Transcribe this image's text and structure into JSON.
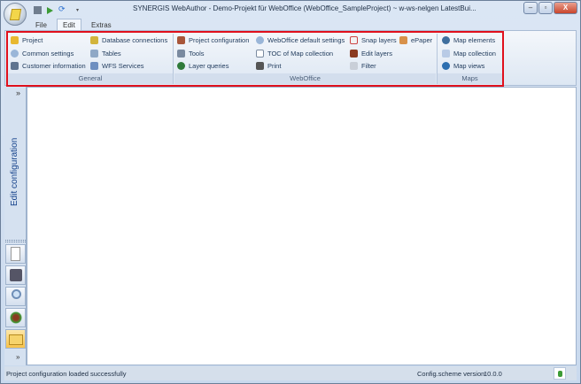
{
  "window": {
    "title": "SYNERGIS WebAuthor - Demo-Projekt für WebOffice (WebOffice_SampleProject) ~ w-ws-nelgen LatestBui...",
    "minimize": "–",
    "maximize": "▫",
    "close": "X"
  },
  "tabs": [
    {
      "label": "File"
    },
    {
      "label": "Edit"
    },
    {
      "label": "Extras"
    }
  ],
  "groups": {
    "general": "General",
    "weboffice": "WebOffice",
    "maps": "Maps"
  },
  "items": {
    "project": "Project",
    "common_settings": "Common settings",
    "customer_information": "Customer information",
    "database_connections": "Database connections",
    "tables": "Tables",
    "wfs_services": "WFS Services",
    "project_configuration": "Project configuration",
    "tools": "Tools",
    "layer_queries": "Layer queries",
    "weboffice_default_settings": "WebOffice default settings",
    "toc_map_collection": "TOC of Map collection",
    "print": "Print",
    "snap_layers": "Snap layers",
    "edit_layers": "Edit layers",
    "filter": "Filter",
    "epaper": "ePaper",
    "map_elements": "Map elements",
    "map_collection": "Map collection",
    "map_views": "Map views"
  },
  "leftpanel": {
    "title": "Edit configuration",
    "expand": "»",
    "more": "»"
  },
  "status": {
    "message": "Project configuration loaded successfully",
    "version_label": "Config.scheme version:",
    "version": "10.0.0"
  },
  "colors": {
    "highlight": "#e0101c",
    "accent": "#15428b"
  }
}
